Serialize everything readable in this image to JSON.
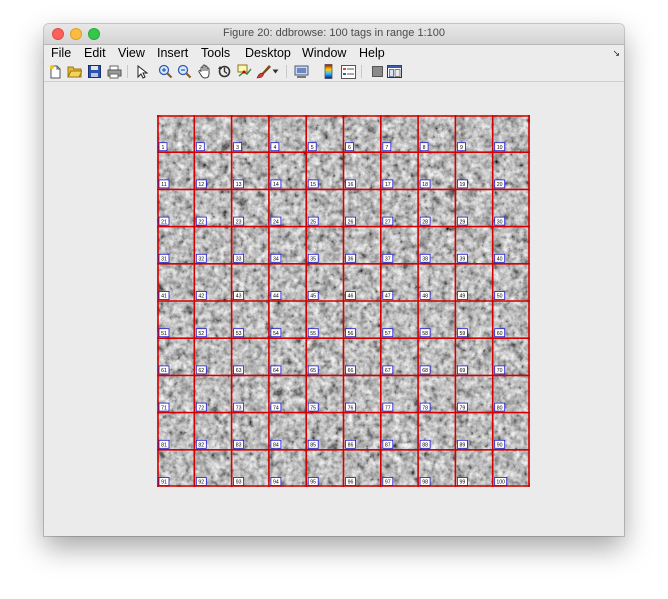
{
  "window": {
    "title": "Figure 20: ddbrowse: 100 tags in range 1:100"
  },
  "menu": {
    "items": [
      "File",
      "Edit",
      "View",
      "Insert",
      "Tools",
      "Desktop",
      "Window",
      "Help"
    ],
    "overflow_icon": "dock-arrow-icon"
  },
  "toolbar": {
    "icons": [
      "new-figure-icon",
      "open-file-icon",
      "save-icon",
      "print-icon",
      "pointer-icon",
      "zoom-in-icon",
      "zoom-out-icon",
      "pan-icon",
      "rotate-3d-icon",
      "data-cursor-icon",
      "brush-icon",
      "brush-dropdown-icon",
      "link-plot-icon",
      "colorbar-icon",
      "legend-icon",
      "hide-plot-tools-icon",
      "show-plot-tools-icon"
    ]
  },
  "montage": {
    "rows": 10,
    "cols": 10,
    "grid_color": "#d40000",
    "label_border_color": "#1a1acc",
    "labels": [
      "1",
      "2",
      "3",
      "4",
      "5",
      "6",
      "7",
      "8",
      "9",
      "10",
      "11",
      "12",
      "13",
      "14",
      "15",
      "16",
      "17",
      "18",
      "19",
      "20",
      "21",
      "22",
      "23",
      "24",
      "25",
      "26",
      "27",
      "28",
      "29",
      "30",
      "31",
      "32",
      "33",
      "34",
      "35",
      "36",
      "37",
      "38",
      "39",
      "40",
      "41",
      "42",
      "43",
      "44",
      "45",
      "46",
      "47",
      "48",
      "49",
      "50",
      "51",
      "52",
      "53",
      "54",
      "55",
      "56",
      "57",
      "58",
      "59",
      "60",
      "61",
      "62",
      "63",
      "64",
      "65",
      "66",
      "67",
      "68",
      "69",
      "70",
      "71",
      "72",
      "73",
      "74",
      "75",
      "76",
      "77",
      "78",
      "79",
      "80",
      "81",
      "82",
      "83",
      "84",
      "85",
      "86",
      "87",
      "88",
      "89",
      "90",
      "91",
      "92",
      "93",
      "94",
      "95",
      "96",
      "97",
      "98",
      "99",
      "100"
    ]
  }
}
